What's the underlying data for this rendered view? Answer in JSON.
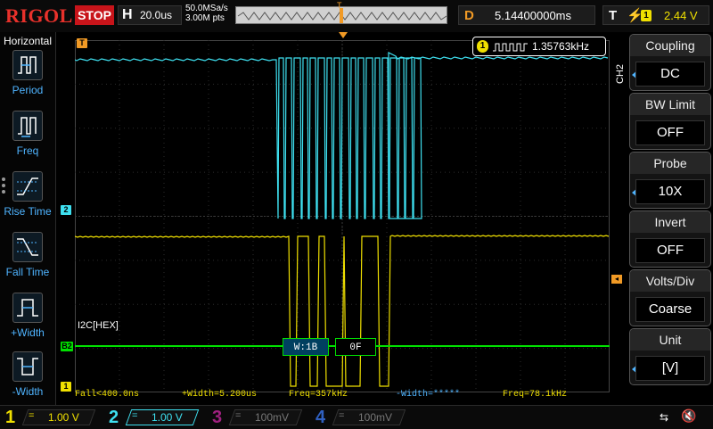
{
  "topbar": {
    "brand": "RIGOL",
    "run_state": "STOP",
    "horizontal_key": "H",
    "timebase": "20.0us",
    "sample_rate": "50.0MSa/s",
    "memory_points": "3.00M pts",
    "trigger_marker": "T",
    "delay_key": "D",
    "delay_value": "5.14400000ms",
    "trigger_key": "T",
    "trigger_channel": "1",
    "trigger_level": "2.44 V"
  },
  "left_menu": {
    "title": "Horizontal",
    "items": [
      {
        "label": "Period",
        "icon": "period-icon"
      },
      {
        "label": "Freq",
        "icon": "frequency-icon"
      },
      {
        "label": "Rise Time",
        "icon": "rise-time-icon"
      },
      {
        "label": "Fall Time",
        "icon": "fall-time-icon"
      },
      {
        "label": "+Width",
        "icon": "positive-width-icon"
      },
      {
        "label": "-Width",
        "icon": "negative-width-icon"
      }
    ]
  },
  "screen": {
    "freq_counter": {
      "channel": "1",
      "value": "1.35763kHz"
    },
    "bus_label": "I2C[HEX]",
    "bus_packets": [
      "W:1B",
      "0F"
    ],
    "markers": {
      "ch1": "1",
      "ch2": "2",
      "bus": "B2",
      "trigger": "T"
    }
  },
  "measurements": [
    "Fall<400.0ns",
    "+Width=5.200us",
    "Freq=357kHz",
    "-Width=*****",
    "Freq=78.1kHz"
  ],
  "right_menu": {
    "channel_label": "CH2",
    "items": [
      {
        "title": "Coupling",
        "value": "DC",
        "has_arrow": true
      },
      {
        "title": "BW Limit",
        "value": "OFF",
        "has_arrow": false
      },
      {
        "title": "Probe",
        "value": "10X",
        "has_arrow": true
      },
      {
        "title": "Invert",
        "value": "OFF",
        "has_arrow": false
      },
      {
        "title": "Volts/Div",
        "value": "Coarse",
        "has_arrow": false
      },
      {
        "title": "Unit",
        "value": "[V]",
        "has_arrow": true
      }
    ]
  },
  "bottom_bar": {
    "channels": [
      {
        "num": "1",
        "scale": "1.00 V",
        "color": "#f0e000"
      },
      {
        "num": "2",
        "scale": "1.00 V",
        "color": "#3ee0f0"
      },
      {
        "num": "3",
        "scale": "100mV",
        "color": "#a02080"
      },
      {
        "num": "4",
        "scale": "100mV",
        "color": "#3060c0"
      }
    ],
    "coupling_symbol": "="
  },
  "colors": {
    "ch1": "#f0e000",
    "ch2": "#3ee0f0",
    "bus": "#00e000",
    "trigger": "#f19a25",
    "accent": "#4fb4ff"
  }
}
